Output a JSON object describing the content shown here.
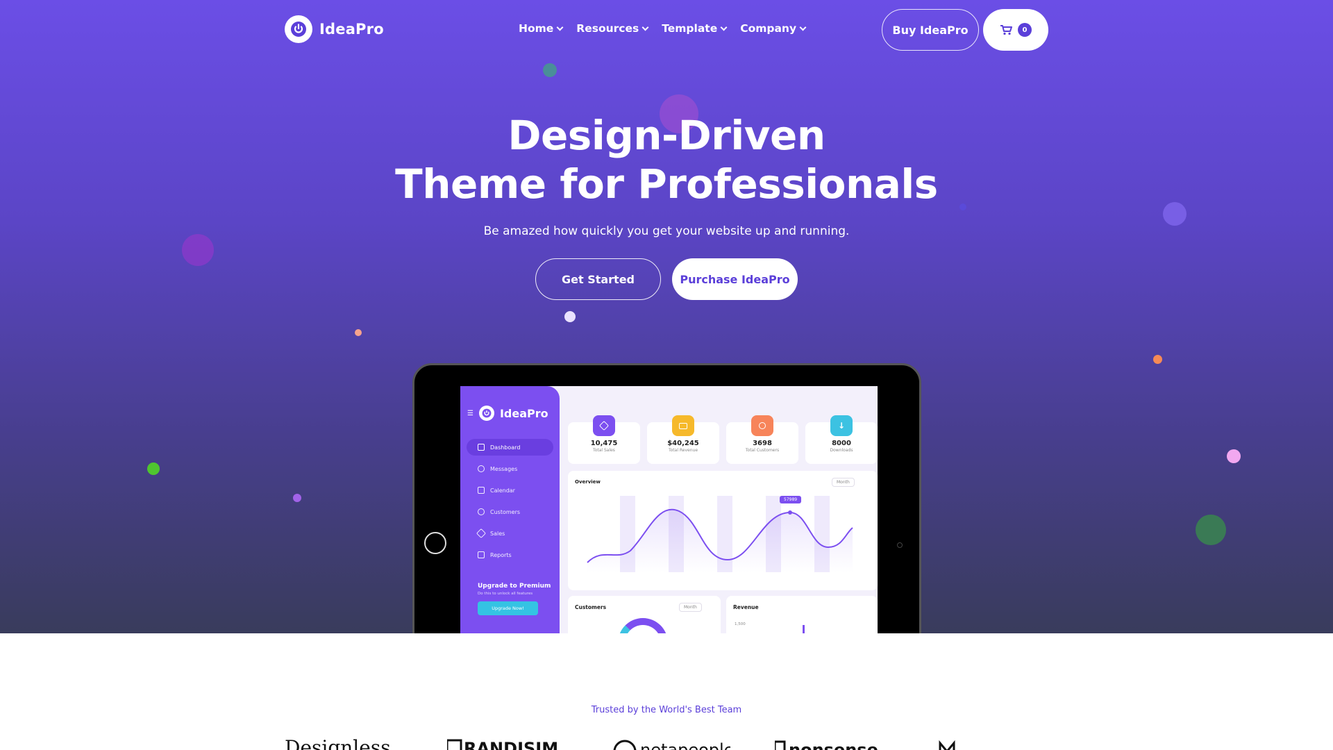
{
  "nav": {
    "logo_text": "IdeaPro",
    "menu": [
      {
        "label": "Home"
      },
      {
        "label": "Resources"
      },
      {
        "label": "Template"
      },
      {
        "label": "Company"
      }
    ],
    "buy_label": "Buy IdeaPro",
    "cart_count": "0"
  },
  "hero": {
    "headline_1": "Design-Driven",
    "headline_2": "Theme for Professionals",
    "subline": "Be amazed how quickly you get your website up and running.",
    "primary_cta": "Get Started",
    "secondary_cta": "Purchase IdeaPro"
  },
  "mockup": {
    "logo_text": "IdeaPro",
    "sidebar": [
      {
        "label": "Dashboard",
        "active": true
      },
      {
        "label": "Messages"
      },
      {
        "label": "Calendar"
      },
      {
        "label": "Customers"
      },
      {
        "label": "Sales"
      },
      {
        "label": "Reports"
      }
    ],
    "upgrade_title": "Upgrade to Premium",
    "upgrade_sub": "Do this to unlock all features",
    "upgrade_button": "Upgrade Now!",
    "stats": [
      {
        "value": "10,475",
        "label": "Total Sales",
        "color": "#7c4ff0",
        "icon": "tag-icon"
      },
      {
        "value": "$40,245",
        "label": "Total Revenue",
        "color": "#f6b92b",
        "icon": "wallet-icon"
      },
      {
        "value": "3698",
        "label": "Total Customers",
        "color": "#f7845a",
        "icon": "users-icon"
      },
      {
        "value": "8000",
        "label": "Downloads",
        "color": "#3cc2e2",
        "icon": "download-icon"
      }
    ],
    "overview_title": "Overview",
    "overview_range": "Month",
    "overview_tooltip": "57989",
    "customers_title": "Customers",
    "customers_range": "Month",
    "revenue_title": "Revenue",
    "revenue_tick": "1,500"
  },
  "trusted": {
    "label": "Trusted by the World's Best Team"
  },
  "colors": {
    "accent": "#5b3fd9",
    "hero_top": "#6b4ee6",
    "hero_bottom": "#393c5c"
  }
}
